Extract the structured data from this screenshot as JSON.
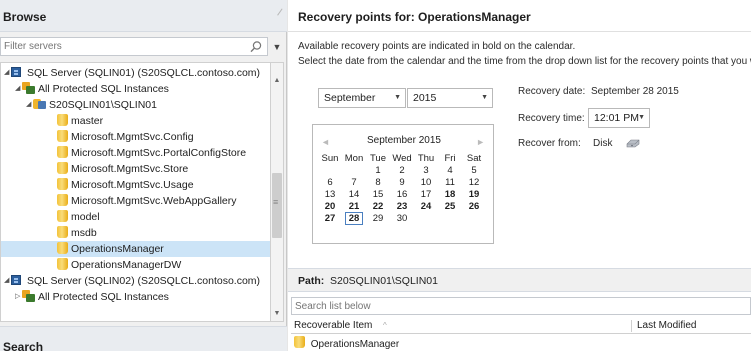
{
  "browse": {
    "title": "Browse",
    "filter_placeholder": "Filter servers",
    "tree": [
      {
        "label": "SQL Server (SQLIN01) (S20SQLCL.contoso.com)",
        "icon": "server-icon",
        "expander": "◢"
      },
      {
        "label": "All Protected SQL Instances",
        "icon": "protected-instances-icon",
        "expander": "◢"
      },
      {
        "label": "S20SQLIN01\\SQLIN01",
        "icon": "sql-instance-icon",
        "expander": "◢"
      },
      {
        "label": "master",
        "icon": "database-icon"
      },
      {
        "label": "Microsoft.MgmtSvc.Config",
        "icon": "database-icon"
      },
      {
        "label": "Microsoft.MgmtSvc.PortalConfigStore",
        "icon": "database-icon"
      },
      {
        "label": "Microsoft.MgmtSvc.Store",
        "icon": "database-icon"
      },
      {
        "label": "Microsoft.MgmtSvc.Usage",
        "icon": "database-icon"
      },
      {
        "label": "Microsoft.MgmtSvc.WebAppGallery",
        "icon": "database-icon"
      },
      {
        "label": "model",
        "icon": "database-icon"
      },
      {
        "label": "msdb",
        "icon": "database-icon"
      },
      {
        "label": "OperationsManager",
        "icon": "database-icon",
        "selected": true
      },
      {
        "label": "OperationsManagerDW",
        "icon": "database-icon"
      },
      {
        "label": "SQL Server (SQLIN02) (S20SQLCL.contoso.com)",
        "icon": "server-icon",
        "expander": "◢"
      },
      {
        "label": "All Protected SQL Instances",
        "icon": "protected-instances-icon",
        "expander": "▷"
      }
    ]
  },
  "search": {
    "title": "Search"
  },
  "recovery": {
    "title": "Recovery points for:  OperationsManager",
    "hint_bold": "Available recovery points are indicated in bold on the calendar.",
    "hint_select": "Select the date from the calendar and the time from the drop down list for the recovery points that you want",
    "month": "September",
    "year": "2015",
    "calendar": {
      "title": "September 2015",
      "days": [
        "Sun",
        "Mon",
        "Tue",
        "Wed",
        "Thu",
        "Fri",
        "Sat"
      ],
      "weeks": [
        [
          "",
          "",
          "1",
          "2",
          "3",
          "4",
          "5"
        ],
        [
          "6",
          "7",
          "8",
          "9",
          "10",
          "11",
          "12"
        ],
        [
          "13",
          "14",
          "15",
          "16",
          "17",
          "18",
          "19"
        ],
        [
          "20",
          "21",
          "22",
          "23",
          "24",
          "25",
          "26"
        ],
        [
          "27",
          "28",
          "29",
          "30",
          "",
          "",
          ""
        ]
      ],
      "bold_days": [
        "18",
        "19",
        "20",
        "21",
        "22",
        "23",
        "24",
        "25",
        "26",
        "27",
        "28"
      ],
      "selected_day": "28"
    },
    "date_label": "Recovery date:",
    "date_value": "September 28 2015",
    "time_label": "Recovery time:",
    "time_value": "12:01 PM",
    "from_label": "Recover from:",
    "from_value": "Disk",
    "from_icon": "disk-icon"
  },
  "path": {
    "label": "Path:",
    "value": "S20SQLIN01\\SQLIN01"
  },
  "list": {
    "search_placeholder": "Search list below",
    "columns": [
      "Recoverable Item",
      "Last Modified"
    ],
    "rows": [
      {
        "name": "OperationsManager",
        "modified": ""
      }
    ]
  },
  "colors": {
    "selection": "#cce4f7",
    "db_icon": "#f3c33a",
    "server_icon": "#2c5f9e"
  }
}
